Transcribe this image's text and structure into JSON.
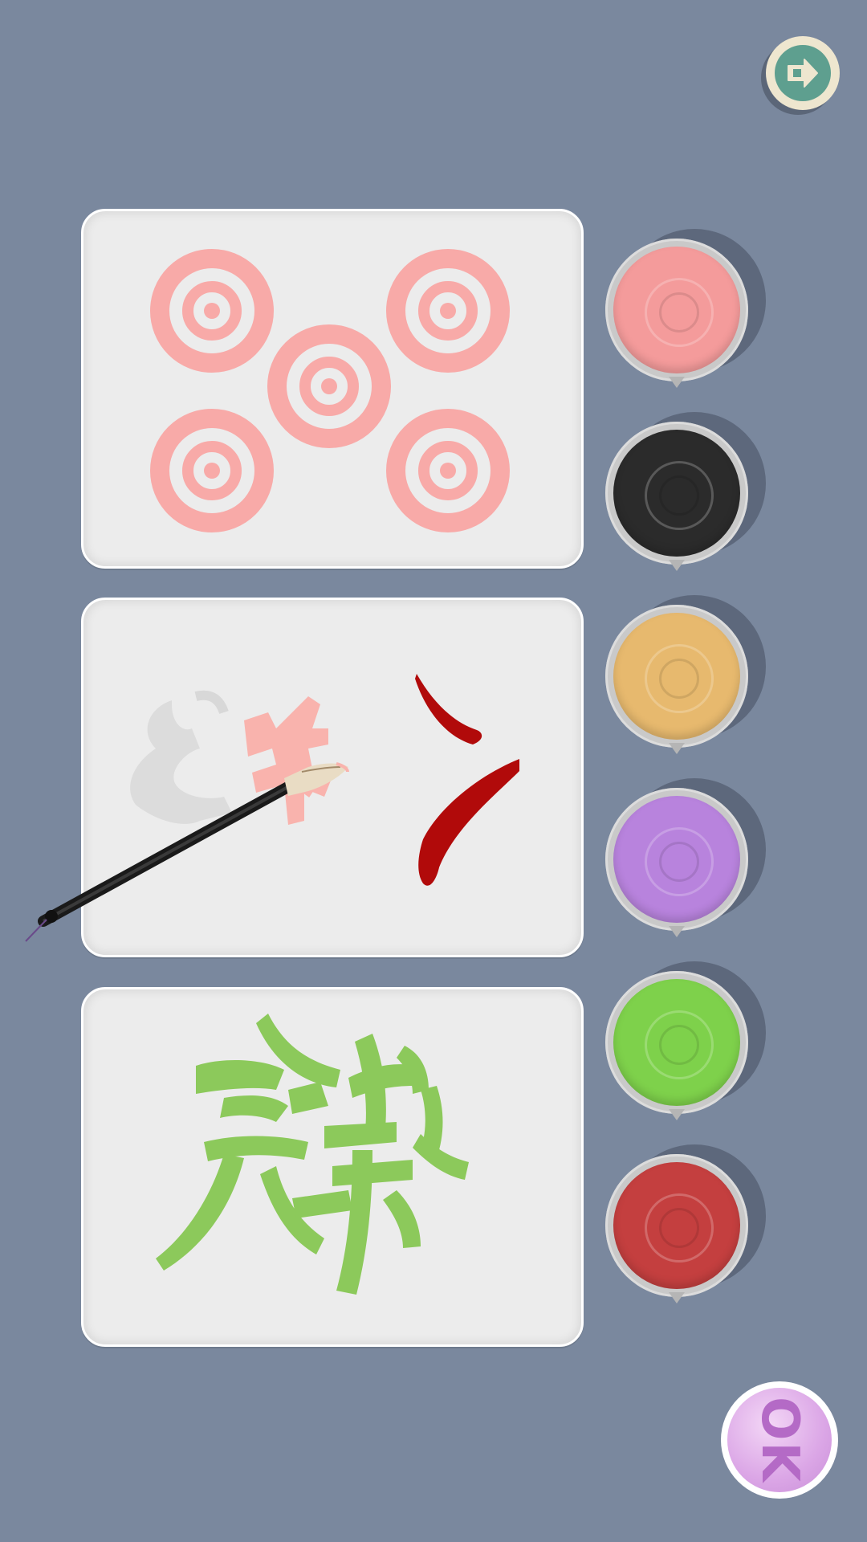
{
  "controls": {
    "exit_icon": "exit-arrow-icon",
    "ok_label": "OK"
  },
  "boards": [
    {
      "name": "board-targets",
      "pattern": "concentric-circles",
      "count": 5,
      "color": "#f8aaa8"
    },
    {
      "name": "board-character-in-progress",
      "pattern": "calligraphy-strokes",
      "color": "#b10a0a",
      "guide_color": "#f9b3ad"
    },
    {
      "name": "board-calligraphy-green",
      "pattern": "calligraphy-character",
      "color": "#8cc95b"
    }
  ],
  "paint_pots": [
    {
      "name": "paint-pot-pink",
      "color": "#f49b9b"
    },
    {
      "name": "paint-pot-black",
      "color": "#2b2b2b"
    },
    {
      "name": "paint-pot-gold",
      "color": "#e7b96e"
    },
    {
      "name": "paint-pot-purple",
      "color": "#b883dd"
    },
    {
      "name": "paint-pot-green",
      "color": "#7ed14b"
    },
    {
      "name": "paint-pot-red",
      "color": "#c43f3f"
    }
  ],
  "tool": {
    "name": "calligraphy-brush-icon"
  }
}
